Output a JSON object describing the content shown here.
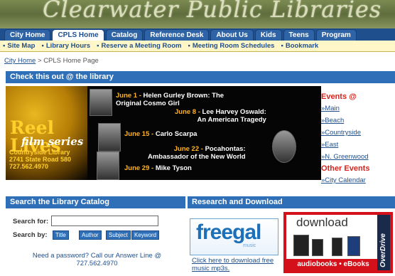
{
  "header": {
    "site_title": "Clearwater Public Libraries"
  },
  "nav": {
    "tabs": [
      "City Home",
      "CPLS Home",
      "Catalog",
      "Reference Desk",
      "About Us",
      "Kids",
      "Teens",
      "Program"
    ]
  },
  "subnav": {
    "links": [
      "Site Map",
      "Library Hours",
      "Reserve a Meeting Room",
      "Meeting Room Schedules",
      "Bookmark"
    ]
  },
  "breadcrumb": {
    "home": "City Home",
    "sep": ">",
    "current": "CPLS Home Page"
  },
  "feature": {
    "heading": "Check this out @ the library",
    "reel_title": "Reel Lives",
    "reel_subtitle": "film series",
    "location": [
      "Countryside Library",
      "2741 State Road 580",
      "727.562.4970"
    ],
    "films": [
      {
        "date": "June 1 -",
        "text": "Helen Gurley Brown: The",
        "text2": "Original Cosmo Girl"
      },
      {
        "date": "June 8 -",
        "text": "Lee Harvey Oswald:",
        "text2": "An American Tragedy"
      },
      {
        "date": "June 15 -",
        "text": "Carlo Scarpa"
      },
      {
        "date": "June 22 -",
        "text": "Pocahontas:",
        "text2": "Ambassador of the New World"
      },
      {
        "date": "June 29 -",
        "text": "Mike Tyson"
      }
    ]
  },
  "events": {
    "heading": "Events @",
    "items": [
      "Main",
      "Beach",
      "Countryside",
      "East",
      "N. Greenwood"
    ],
    "other_heading": "Other Events",
    "other_items": [
      "City Calendar"
    ]
  },
  "catalog": {
    "heading": "Search the Library Catalog",
    "search_for_label": "Search for:",
    "search_value": "",
    "search_by_label": "Search by:",
    "buttons": [
      "Title",
      "Author",
      "Subject",
      "Keyword"
    ],
    "password_note": "Need a password? Call our Answer Line @ 727.562.4970"
  },
  "research": {
    "heading": "Research and Download",
    "freegal_logo": "freegal",
    "freegal_tag": "music",
    "freegal_link": "Click here to download free music mp3s.",
    "overdrive_download": "download",
    "overdrive_footer": "audiobooks • eBooks",
    "overdrive_brand": "OverDrive"
  }
}
